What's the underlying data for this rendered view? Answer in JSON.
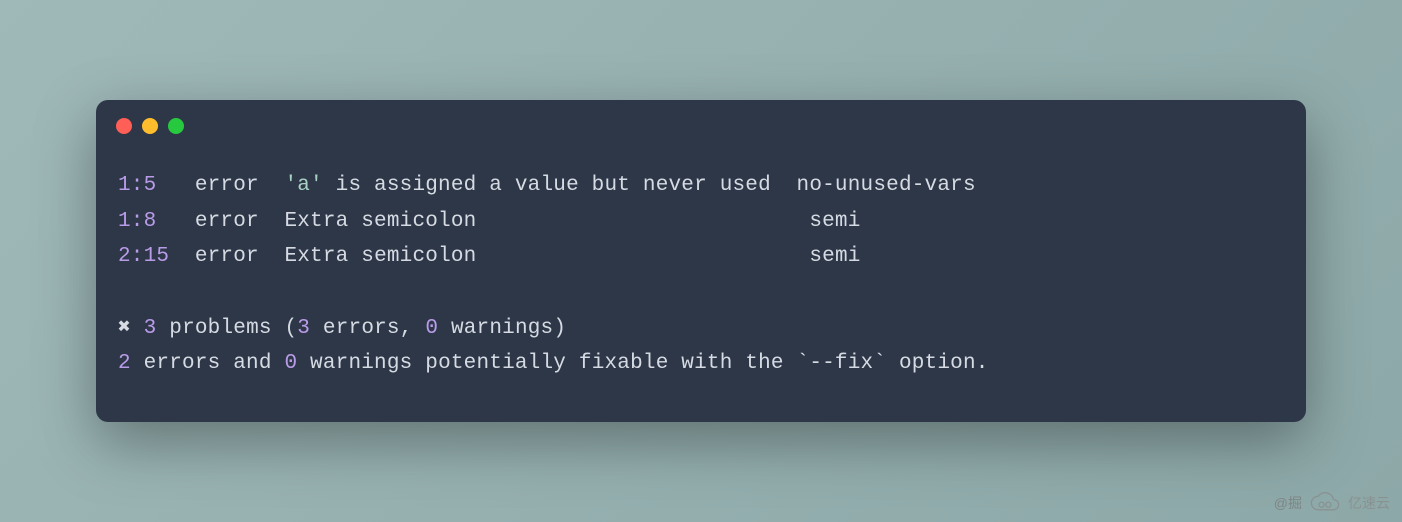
{
  "lint": {
    "entries": [
      {
        "location": "1:5",
        "severity": "error",
        "quoted": "'a'",
        "message_rest": " is assigned a value but never used",
        "rule": "no-unused-vars"
      },
      {
        "location": "1:8",
        "severity": "error",
        "quoted": "",
        "message_rest": "Extra semicolon",
        "rule": "semi"
      },
      {
        "location": "2:15",
        "severity": "error",
        "quoted": "",
        "message_rest": "Extra semicolon",
        "rule": "semi"
      }
    ],
    "summary": {
      "cross": "✖",
      "problems_count": "3",
      "problems_label": " problems (",
      "errors_count": "3",
      "errors_label": " errors, ",
      "warnings_count": "0",
      "warnings_label": " warnings)"
    },
    "fixable": {
      "fixable_errors": "2",
      "mid1": " errors and ",
      "fixable_warnings": "0",
      "mid2": " warnings potentially fixable with the ",
      "flag": "`--fix`",
      "tail": " option."
    }
  },
  "watermark": {
    "prefix": "@掘",
    "brand": "亿速云"
  }
}
